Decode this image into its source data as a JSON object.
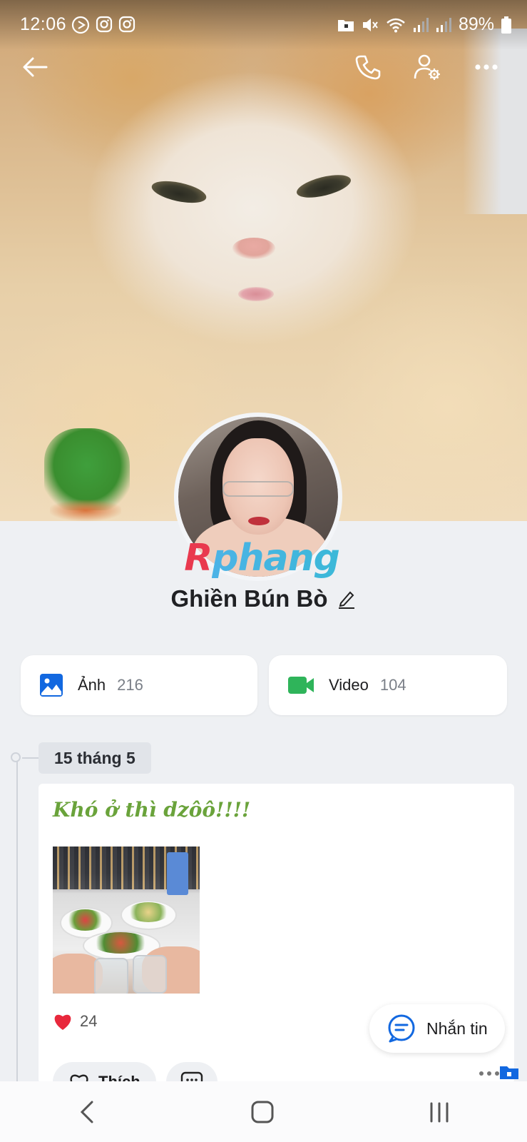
{
  "status_bar": {
    "time": "12:06",
    "battery": "89%"
  },
  "header": {
    "back_icon": "back-arrow-icon",
    "call_icon": "phone-icon",
    "settings_icon": "user-settings-icon",
    "more_icon": "more-horizontal-icon"
  },
  "profile": {
    "name": "Ghiền Bún Bò",
    "watermark_r": "R",
    "watermark_rest": "phang"
  },
  "media": {
    "photos_label": "Ảnh",
    "photos_count": "216",
    "videos_label": "Video",
    "videos_count": "104"
  },
  "timeline": {
    "date": "15 tháng 5",
    "post": {
      "text": "Khó ở thì dzôô!!!!",
      "likes": "24",
      "like_label": "Thích"
    }
  },
  "message_button": {
    "label": "Nhắn tin"
  },
  "colors": {
    "accent_blue": "#1268e0",
    "video_green": "#2fb45a",
    "post_text_green": "#6aa33b",
    "heart_red": "#e8283c"
  }
}
